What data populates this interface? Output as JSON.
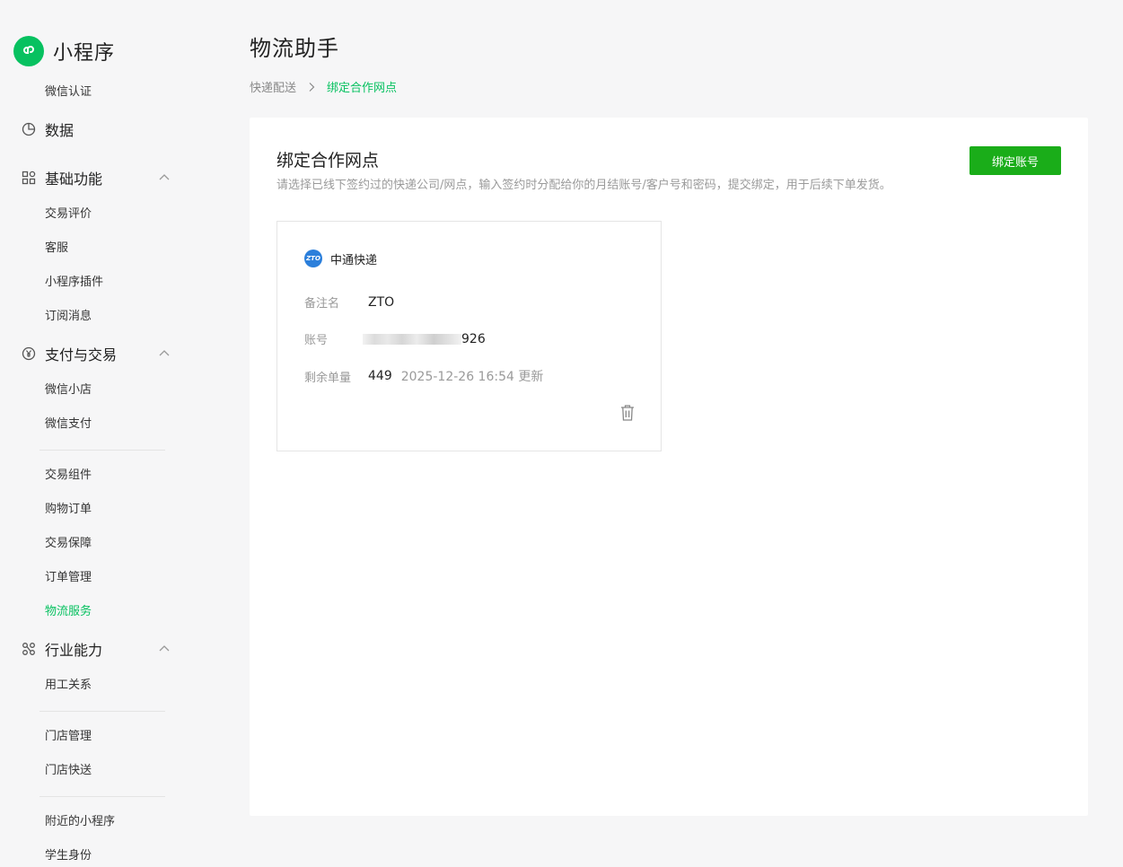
{
  "app": {
    "name": "小程序"
  },
  "sidebar": {
    "items": [
      {
        "type": "sub",
        "label": "微信认证"
      },
      {
        "type": "group",
        "label": "数据"
      },
      {
        "type": "group",
        "label": "基础功能"
      },
      {
        "type": "sub",
        "label": "交易评价"
      },
      {
        "type": "sub",
        "label": "客服"
      },
      {
        "type": "sub",
        "label": "小程序插件"
      },
      {
        "type": "sub",
        "label": "订阅消息"
      },
      {
        "type": "group",
        "label": "支付与交易"
      },
      {
        "type": "sub",
        "label": "微信小店"
      },
      {
        "type": "sub",
        "label": "微信支付"
      },
      {
        "type": "sub",
        "label": "交易组件"
      },
      {
        "type": "sub",
        "label": "购物订单"
      },
      {
        "type": "sub",
        "label": "交易保障"
      },
      {
        "type": "sub",
        "label": "订单管理"
      },
      {
        "type": "sub",
        "label": "物流服务",
        "active": true
      },
      {
        "type": "group",
        "label": "行业能力"
      },
      {
        "type": "sub",
        "label": "用工关系"
      },
      {
        "type": "sub",
        "label": "门店管理"
      },
      {
        "type": "sub",
        "label": "门店快送"
      },
      {
        "type": "sub",
        "label": "附近的小程序"
      },
      {
        "type": "sub",
        "label": "学生身份"
      }
    ]
  },
  "page": {
    "title": "物流助手",
    "breadcrumb": {
      "parent": "快递配送",
      "current": "绑定合作网点"
    }
  },
  "panel": {
    "title": "绑定合作网点",
    "description": "请选择已线下签约过的快递公司/网点，输入签约时分配给你的月结账号/客户号和密码，提交绑定，用于后续下单发货。",
    "bind_button": "绑定账号"
  },
  "card": {
    "carrier_logo_text": "ZTO",
    "carrier_name": "中通快递",
    "remark_label": "备注名",
    "remark_value": "ZTO",
    "account_label": "账号",
    "account_value_suffix": "926",
    "remaining_label": "剩余单量",
    "remaining_value": "449",
    "updated_text": "2025-12-26 16:54 更新"
  },
  "colors": {
    "brand": "#07c160",
    "button": "#1aad19",
    "carrier": "#2b7fdb"
  }
}
